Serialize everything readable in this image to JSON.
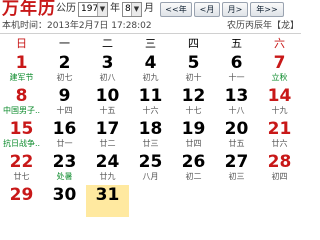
{
  "app_title": "万年历",
  "controls": {
    "era_label": "公历",
    "year_value": "1976",
    "year_suffix": "年",
    "month_value": "8",
    "month_suffix": "月",
    "prev_year": "<<年",
    "prev_month": "<月",
    "next_month": "月>",
    "next_year": "年>>",
    "dropdown_arrow": "▼"
  },
  "status": {
    "current_time": "本机时间：2013年2月7日 17:28:02",
    "lunar_year": "农历丙辰年【龙】"
  },
  "weekdays": [
    "日",
    "一",
    "二",
    "三",
    "四",
    "五",
    "六"
  ],
  "rows": [
    [
      {
        "day": "1",
        "lunar": "建军节",
        "kind": "fest"
      },
      {
        "day": "2",
        "lunar": "初七"
      },
      {
        "day": "3",
        "lunar": "初八"
      },
      {
        "day": "4",
        "lunar": "初九"
      },
      {
        "day": "5",
        "lunar": "初十"
      },
      {
        "day": "6",
        "lunar": "十一"
      },
      {
        "day": "7",
        "lunar": "立秋",
        "kind": "fest"
      }
    ],
    [
      {
        "day": "8",
        "lunar": "中国男子..",
        "kind": "fest"
      },
      {
        "day": "9",
        "lunar": "十四"
      },
      {
        "day": "10",
        "lunar": "十五"
      },
      {
        "day": "11",
        "lunar": "十六"
      },
      {
        "day": "12",
        "lunar": "十七"
      },
      {
        "day": "13",
        "lunar": "十八"
      },
      {
        "day": "14",
        "lunar": "十九"
      }
    ],
    [
      {
        "day": "15",
        "lunar": "抗日战争..",
        "kind": "fest"
      },
      {
        "day": "16",
        "lunar": "廿一"
      },
      {
        "day": "17",
        "lunar": "廿二"
      },
      {
        "day": "18",
        "lunar": "廿三"
      },
      {
        "day": "19",
        "lunar": "廿四"
      },
      {
        "day": "20",
        "lunar": "廿五"
      },
      {
        "day": "21",
        "lunar": "廿六"
      }
    ],
    [
      {
        "day": "22",
        "lunar": "廿七"
      },
      {
        "day": "23",
        "lunar": "处暑",
        "kind": "fest"
      },
      {
        "day": "24",
        "lunar": "廿九"
      },
      {
        "day": "25",
        "lunar": "八月"
      },
      {
        "day": "26",
        "lunar": "初二"
      },
      {
        "day": "27",
        "lunar": "初三"
      },
      {
        "day": "28",
        "lunar": "初四"
      }
    ],
    [
      {
        "day": "29",
        "lunar": ""
      },
      {
        "day": "30",
        "lunar": ""
      },
      {
        "day": "31",
        "lunar": "",
        "today": true
      }
    ]
  ]
}
